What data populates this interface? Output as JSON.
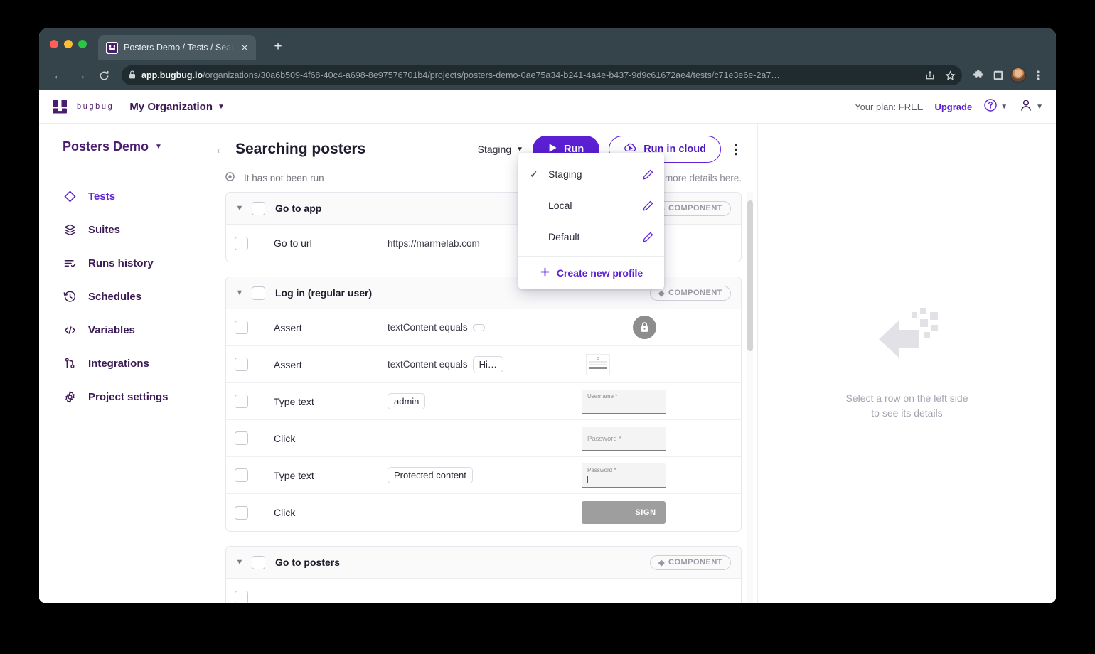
{
  "browser": {
    "tab": {
      "title": "Posters Demo / Tests / Searchi",
      "close": "×",
      "favicon": "bugbug-favicon"
    },
    "new_tab": "+",
    "nav": {
      "back": "←",
      "forward": "→",
      "reload": "⟳"
    },
    "omnibox": {
      "lock": "🔒",
      "url_host": "app.bugbug.io",
      "url_path": "/organizations/30a6b509-4f68-40c4-a698-8e97576701b4/projects/posters-demo-0ae75a34-b241-4a4e-b437-9d9c61672ae4/tests/c71e3e6e-2a7…"
    },
    "actions": [
      "share-icon",
      "bookmark-star-icon",
      "extensions-puzzle-icon",
      "side-panel-icon",
      "profile-avatar",
      "browser-menu-icon"
    ]
  },
  "appbar": {
    "logo_word": "bugbug",
    "organization": "My Organization",
    "plan_label": "Your plan: FREE",
    "upgrade": "Upgrade",
    "help_icon": "question-circle-icon",
    "account_icon": "person-icon"
  },
  "sidebar": {
    "project": "Posters Demo",
    "items": [
      {
        "label": "Tests",
        "icon": "diamond-icon",
        "active": true
      },
      {
        "label": "Suites",
        "icon": "layers-icon",
        "active": false
      },
      {
        "label": "Runs history",
        "icon": "list-check-icon",
        "active": false
      },
      {
        "label": "Schedules",
        "icon": "clock-rewind-icon",
        "active": false
      },
      {
        "label": "Variables",
        "icon": "code-brackets-icon",
        "active": false
      },
      {
        "label": "Integrations",
        "icon": "node-connect-icon",
        "active": false
      },
      {
        "label": "Project settings",
        "icon": "gear-icon",
        "active": false
      }
    ]
  },
  "main": {
    "back_icon": "arrow-left-icon",
    "title": "Searching posters",
    "profile_selected": "Staging",
    "run_label": "Run",
    "run_cloud_label": "Run in cloud",
    "kebab": "⋮",
    "status_text": "It has not been run",
    "status_right_text": "ou'll see more details here.",
    "component_badge": "COMPONENT"
  },
  "profile_menu": {
    "items": [
      {
        "label": "Staging",
        "checked": true,
        "edit_icon": "pencil-icon"
      },
      {
        "label": "Local",
        "checked": false,
        "edit_icon": "pencil-icon"
      },
      {
        "label": "Default",
        "checked": false,
        "edit_icon": "pencil-icon"
      }
    ],
    "create_label": "Create new profile",
    "create_icon": "plus-icon"
  },
  "groups": [
    {
      "name": "Go to app",
      "badge": "COMPONENT",
      "steps": [
        {
          "action": "Go to url",
          "value": "https://marmelab.com",
          "chip": false,
          "thumb": "none"
        }
      ]
    },
    {
      "name": "Log in (regular user)",
      "badge": "COMPONENT",
      "steps": [
        {
          "action": "Assert",
          "value": "textContent equals",
          "chip": false,
          "empty_pill": true,
          "thumb": "lock"
        },
        {
          "action": "Assert",
          "value": "textContent equals",
          "chip": true,
          "chip_text": "Hi…",
          "thumb": "form"
        },
        {
          "action": "Type text",
          "value": "",
          "chip": true,
          "chip_text": "admin",
          "thumb": "input",
          "thumb_label": "Username *",
          "thumb_filled": true
        },
        {
          "action": "Click",
          "value": "",
          "chip": false,
          "thumb": "input",
          "thumb_label": "Password *",
          "thumb_filled": false
        },
        {
          "action": "Type text",
          "value": "",
          "chip": true,
          "chip_text": "Protected content",
          "thumb": "input",
          "thumb_label": "Password *",
          "thumb_filled": true,
          "caret": true
        },
        {
          "action": "Click",
          "value": "",
          "chip": false,
          "thumb": "button",
          "thumb_label": "SIGN"
        }
      ]
    },
    {
      "name": "Go to posters",
      "badge": "COMPONENT",
      "steps": []
    }
  ],
  "detail_panel": {
    "icon": "pixel-arrow-left-icon",
    "line1": "Select a row on the left side",
    "line2": "to see its details"
  },
  "colors": {
    "brand_purple": "#5b1fd4",
    "deep_purple": "#3c1a55",
    "accent_orange": "#f5a623",
    "chrome_bg": "#35434a"
  }
}
